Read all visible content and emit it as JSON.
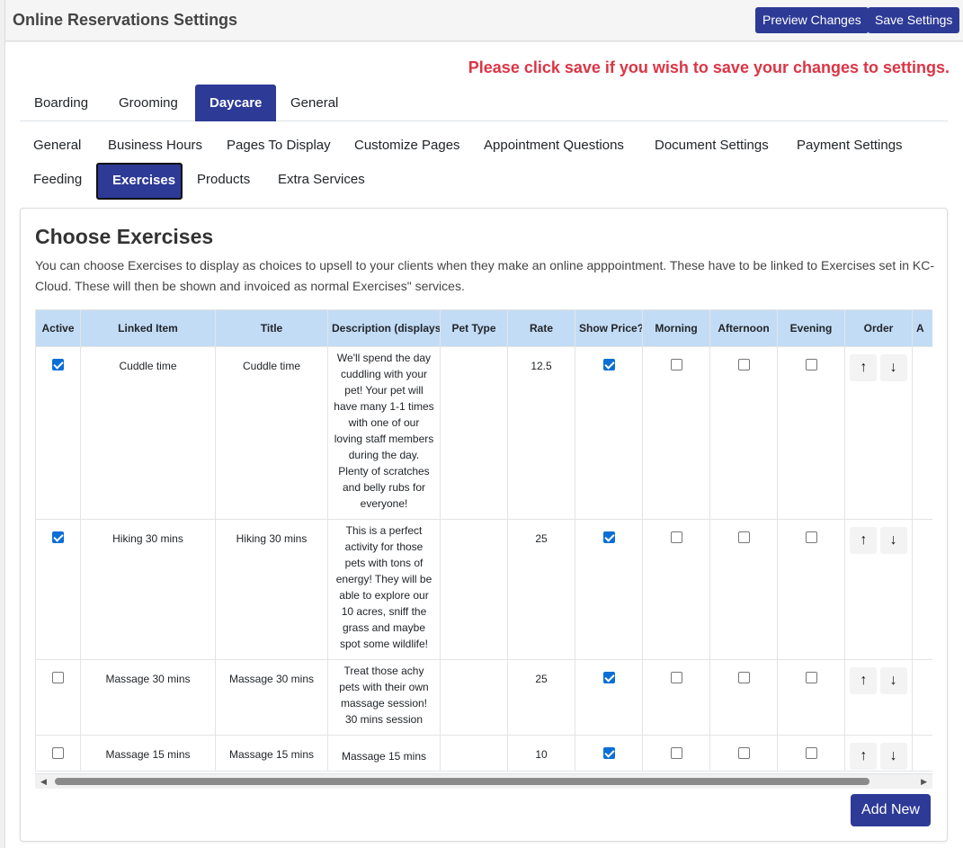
{
  "app": {
    "title": "Online Reservations Settings"
  },
  "toolbar": {
    "preview_label": "Preview Changes",
    "save_label": "Save Settings"
  },
  "warning": "Please click save if you wish to save your changes to settings.",
  "tabs": [
    "Boarding",
    "Grooming",
    "Daycare",
    "General"
  ],
  "active_tab": "Daycare",
  "subtabs": [
    "General",
    "Business Hours",
    "Pages To Display",
    "Customize Pages",
    "Appointment Questions",
    "Document Settings",
    "Payment Settings",
    "Feeding",
    "Exercises",
    "Products",
    "Extra Services"
  ],
  "active_subtab": "Exercises",
  "section": {
    "title": "Choose Exercises",
    "description": "You can choose Exercises to display as choices to upsell to your clients when they make an online apppointment. These have to be linked to Exercises set in KC-Cloud. These will then be shown and invoiced as normal Exercises\" services."
  },
  "table": {
    "headers": [
      "Active",
      "Linked Item",
      "Title",
      "Description (displays",
      "Pet Type",
      "Rate",
      "Show Price?",
      "Morning",
      "Afternoon",
      "Evening",
      "Order",
      "A"
    ],
    "rows": [
      {
        "active": true,
        "linked": "Cuddle time",
        "title": "Cuddle time",
        "description": "We'll spend the day cuddling with your pet!  Your pet will have many 1-1 times with one of our loving staff members during the day. Plenty of scratches and belly rubs for everyone!",
        "pet_type": "",
        "rate": "12.5",
        "show_price": true,
        "morning": false,
        "afternoon": false,
        "evening": false
      },
      {
        "active": true,
        "linked": "Hiking 30 mins",
        "title": "Hiking 30 mins",
        "description": "This is a perfect activity for those pets with tons of energy! They will be able to explore our 10 acres, sniff the grass and maybe spot some wildlife!",
        "pet_type": "",
        "rate": "25",
        "show_price": true,
        "morning": false,
        "afternoon": false,
        "evening": false
      },
      {
        "active": false,
        "linked": "Massage 30 mins",
        "title": "Massage 30 mins",
        "description": "Treat those achy pets with their own massage session!  30 mins session",
        "pet_type": "",
        "rate": "25",
        "show_price": true,
        "morning": false,
        "afternoon": false,
        "evening": false
      },
      {
        "active": false,
        "linked": "Massage 15 mins",
        "title": "Massage 15 mins",
        "description": "Massage 15 mins",
        "pet_type": "",
        "rate": "10",
        "show_price": true,
        "morning": false,
        "afternoon": false,
        "evening": false
      }
    ]
  },
  "order_icons": {
    "up": "↑",
    "down": "↓"
  },
  "scroll_icons": {
    "left": "◀",
    "right": "▶"
  },
  "add_new_label": "Add New",
  "colors": {
    "primary": "#2d3a96",
    "warning": "#dc3545",
    "header_bg": "#c3dcf6",
    "checkbox": "#0b6fd6"
  }
}
